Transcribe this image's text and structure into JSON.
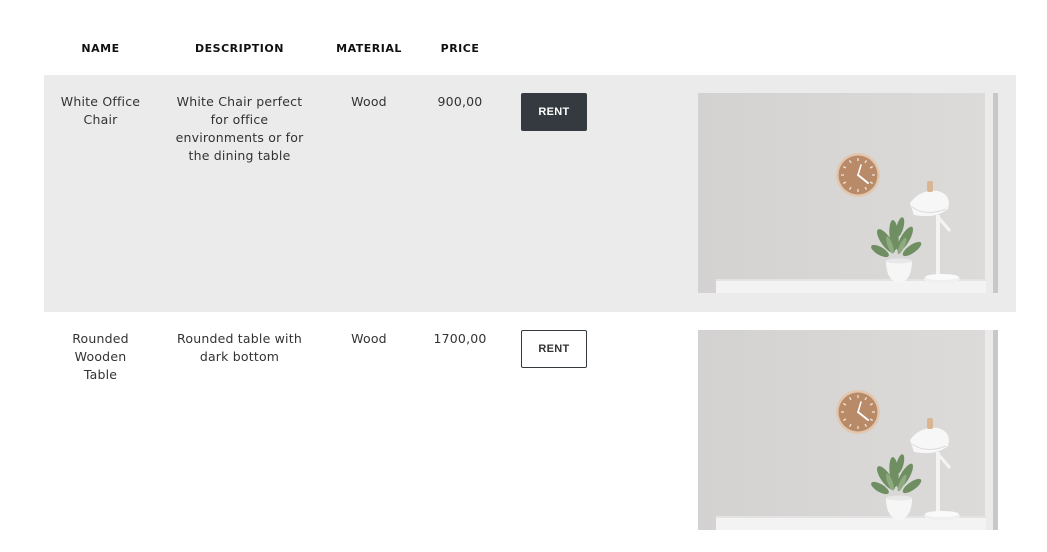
{
  "headers": {
    "name": "NAME",
    "description": "DESCRIPTION",
    "material": "MATERIAL",
    "price": "PRICE"
  },
  "colors": {
    "row_shade": "#ebebeb",
    "button_dark": "#343a40",
    "wall": "#d6d5d4",
    "clock_wood": "#b98a68"
  },
  "rows": [
    {
      "name": "White Office Chair",
      "description": "White Chair perfect for office environments or for the dining table",
      "material": "Wood",
      "price": "900,00",
      "button_label": "RENT",
      "image": "wall-clock-plant-lamp-photo"
    },
    {
      "name": "Rounded Wooden Table",
      "description": "Rounded table with dark bottom",
      "material": "Wood",
      "price": "1700,00",
      "button_label": "RENT",
      "image": "wall-clock-plant-lamp-photo"
    }
  ]
}
